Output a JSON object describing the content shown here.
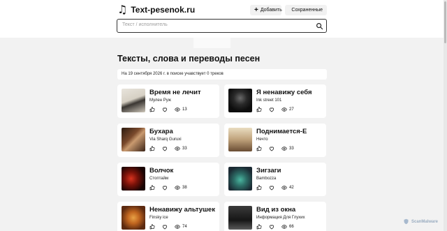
{
  "header": {
    "logo_text": "Text-pesenok.ru",
    "add_label": "Добавить",
    "saved_label": "Сохраненные"
  },
  "search": {
    "placeholder": "Текст / исполнитель"
  },
  "main": {
    "title": "Тексты, слова и переводы песен",
    "info": "На 19 сентября 2026 г. в поиске учавствует 0 треков"
  },
  "songs": [
    {
      "title": "Время не лечит",
      "artist": "Мулен Руж",
      "views": "13"
    },
    {
      "title": "Я ненавижу себя",
      "artist": "Ink street 101",
      "views": "27"
    },
    {
      "title": "Бухара",
      "artist": "Via Sharq Guruxi",
      "views": "33"
    },
    {
      "title": "Поднимается-Е",
      "artist": "Нечто",
      "views": "33"
    },
    {
      "title": "Волчок",
      "artist": "Стоптайм",
      "views": "38"
    },
    {
      "title": "Зигзаги",
      "artist": "Bambozza",
      "views": "42"
    },
    {
      "title": "Ненавижу альтушек",
      "artist": "Finsky ice",
      "views": "74"
    },
    {
      "title": "Вид из окна",
      "artist": "Информация Для Глухих",
      "views": "66"
    }
  ],
  "watermark": {
    "text": "ScanMalware"
  },
  "colors": {
    "background": "#f2f2f2",
    "card": "#ffffff",
    "text": "#111111"
  }
}
